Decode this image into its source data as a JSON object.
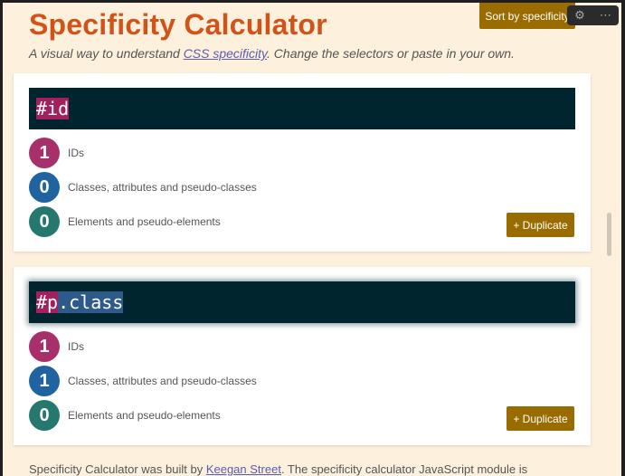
{
  "header": {
    "title": "Specificity Calculator",
    "subtitle_pre": "A visual way to understand ",
    "subtitle_link": "CSS specificity",
    "subtitle_post": ". Change the selectors or paste in your own.",
    "sort_label": "Sort by specificity"
  },
  "labels": {
    "ids": "IDs",
    "classes": "Classes, attributes and pseudo-classes",
    "elements": "Elements and pseudo-elements",
    "duplicate": "+ Duplicate"
  },
  "cards": [
    {
      "selector_highlight": "#id",
      "selector_rest": "",
      "ids": "1",
      "classes": "0",
      "elements": "0"
    },
    {
      "selector_highlight": "#p",
      "selector_rest": ".class",
      "ids": "1",
      "classes": "1",
      "elements": "0"
    }
  ],
  "footer": {
    "pre": "Specificity Calculator was built by ",
    "author": "Keegan Street",
    "post": ". The specificity calculator JavaScript module is"
  },
  "colors": {
    "title": "#d2531a",
    "button": "#9a6c00",
    "id_badge": "#a8306a",
    "class_badge": "#1f63a0",
    "element_badge": "#24786d",
    "selector_bg": "#00252f"
  },
  "icons": [
    "settings-icon",
    "more-icon"
  ]
}
